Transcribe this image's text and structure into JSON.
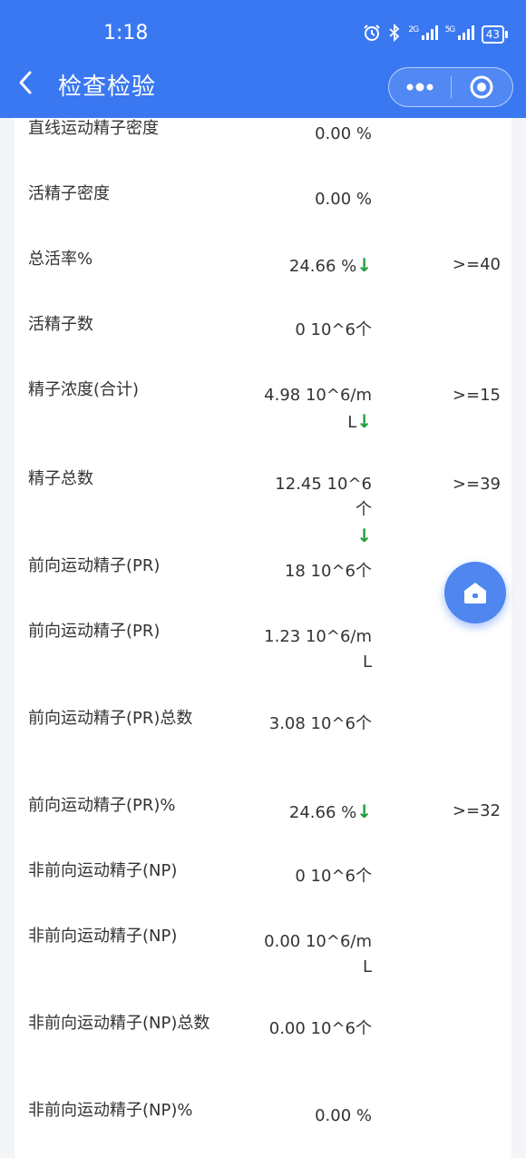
{
  "status_bar": {
    "time": "1:18",
    "icons": [
      "alarm-icon",
      "bluetooth-icon",
      "signal-2g-icon",
      "signal-5g-icon"
    ],
    "network_1": "2G",
    "network_2": "5G",
    "battery": "43"
  },
  "nav": {
    "back_icon": "chevron-left-icon",
    "title": "检查检验",
    "more_icon": "more-dots-icon",
    "close_icon": "target-circle-icon"
  },
  "rows": [
    {
      "name": "直线运动精子密度",
      "value": "0.00 %",
      "value2": "",
      "ref": "",
      "arrow": ""
    },
    {
      "name": "活精子密度",
      "value": "0.00 %",
      "value2": "",
      "ref": "",
      "arrow": ""
    },
    {
      "name": "总活率%",
      "value": "24.66 %",
      "value2": "",
      "ref": ">=40",
      "arrow": "↓"
    },
    {
      "name": "活精子数",
      "value": "0 10^6个",
      "value2": "",
      "ref": "",
      "arrow": ""
    },
    {
      "name": "精子浓度(合计)",
      "value": "4.98 10^6/m",
      "value2": "L",
      "ref": ">=15",
      "arrow": "↓"
    },
    {
      "name": "精子总数",
      "value": "12.45 10^6个",
      "value2": "",
      "ref": ">=39",
      "arrow": "↓"
    },
    {
      "name": "前向运动精子(PR)",
      "value": "18 10^6个",
      "value2": "",
      "ref": "",
      "arrow": ""
    },
    {
      "name": "前向运动精子(PR)",
      "value": "1.23 10^6/m",
      "value2": "L",
      "ref": "",
      "arrow": ""
    },
    {
      "name": "前向运动精子(PR)总数",
      "value": "3.08 10^6个",
      "value2": "",
      "ref": "",
      "arrow": ""
    },
    {
      "name": "前向运动精子(PR)%",
      "value": "24.66 %",
      "value2": "",
      "ref": ">=32",
      "arrow": "↓"
    },
    {
      "name": "非前向运动精子(NP)",
      "value": "0 10^6个",
      "value2": "",
      "ref": "",
      "arrow": ""
    },
    {
      "name": "非前向运动精子(NP)",
      "value": "0.00 10^6/m",
      "value2": "L",
      "ref": "",
      "arrow": ""
    },
    {
      "name": "非前向运动精子(NP)总数",
      "value": "0.00 10^6个",
      "value2": "",
      "ref": "",
      "arrow": ""
    },
    {
      "name": "非前向运动精子(NP)%",
      "value": "0.00 %",
      "value2": "",
      "ref": "",
      "arrow": ""
    }
  ],
  "fab": {
    "icon": "home-icon"
  },
  "colors": {
    "primary": "#3a78f2",
    "down_arrow": "#1f9d3a",
    "fab": "#4f86ef"
  }
}
